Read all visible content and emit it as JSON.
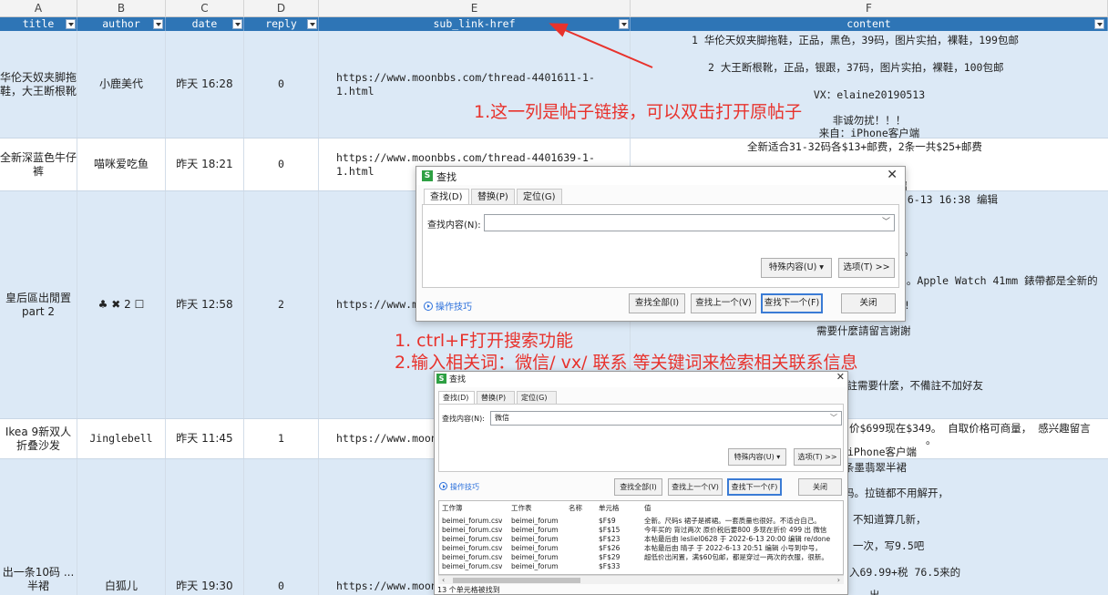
{
  "sheet": {
    "col_letters": [
      "A",
      "B",
      "C",
      "D",
      "E",
      "F"
    ],
    "headers": [
      "title",
      "author",
      "date",
      "reply",
      "sub_link-href",
      "content"
    ],
    "rows": [
      {
        "title": "华伦天奴夹脚拖鞋，大王断根靴",
        "author": "小鹿美代",
        "date": "昨天  16:28",
        "reply": "0",
        "link": "https://www.moonbbs.com/thread-4401611-1-1.html",
        "content": [
          "1 华伦天奴夹脚拖鞋，正品，黑色，39码，图片实拍，裸鞋，199包邮",
          "2 大王断根靴，正品，银跟，37码，图片实拍，裸鞋，100包邮",
          "VX：elaine20190513",
          "非诚勿扰！！！",
          "来自：iPhone客户端"
        ]
      },
      {
        "title": "全新深蓝色牛仔裤",
        "author": "喵咪爱吃鱼",
        "date": "昨天  18:21",
        "reply": "0",
        "link": "https://www.moonbbs.com/thread-4401639-1-1.html",
        "content": [
          "全新适合31-32码各$13+邮费，2条一共$25+邮费",
          "端"
        ]
      },
      {
        "title": "皇后區出閒置 part 2",
        "author": "♣ ✖  2 ☐",
        "date": "昨天  12:58",
        "reply": "2",
        "link": "https://www.mo",
        "content": [
          "2-6-13 16:38 编辑",
          "。",
          "f。Apple Watch 41mm 錶帶都是全新的",
          "!",
          "需要什麼請留言謝謝",
          "請註需要什麼，不備註不加好友"
        ]
      },
      {
        "title": "Ikea 9新双人折叠沙发",
        "author": "Jinglebell",
        "date": "昨天  11:45",
        "reply": "1",
        "link": "https://www.moon",
        "content": [
          "价$699现在$349。 自取价格可商量， 感兴趣留言",
          "。",
          "iPhone客户端"
        ]
      },
      {
        "title": "出一条10码 ... 半裙",
        "author": "白狐儿",
        "date": "昨天  19:30",
        "reply": "0",
        "link": "https://www.moon",
        "content": [
          "条墨翡翠半裙",
          "码。拉链都不用解开，",
          "不知道算几新，",
          "一次，写9.5吧",
          "入69.99+税 76.5来的",
          "出"
        ]
      }
    ]
  },
  "annotations": {
    "a1": "1.这一列是帖子链接，可以双击打开原帖子",
    "a2": "1. ctrl+F打开搜索功能",
    "a3": "2.输入相关词：微信/ vx/ 联系 等关键词来检索相关联系信息"
  },
  "dialog1": {
    "icon": "S",
    "title": "查找",
    "tabs": [
      "查找(D)",
      "替换(P)",
      "定位(G)"
    ],
    "find_label": "查找内容(N):",
    "find_value": "",
    "special_btn": "特殊内容(U) ▾",
    "options_btn": "选项(T) >>",
    "tips": "操作技巧",
    "find_all": "查找全部(I)",
    "find_prev": "查找上一个(V)",
    "find_next": "查找下一个(F)",
    "close": "关闭"
  },
  "dialog2": {
    "icon": "S",
    "title": "查找",
    "tabs": [
      "查找(D)",
      "替换(P)",
      "定位(G)"
    ],
    "find_label": "查找内容(N):",
    "find_value": "微信",
    "special_btn": "特殊内容(U) ▾",
    "options_btn": "选项(T) >>",
    "tips": "操作技巧",
    "find_all": "查找全部(I)",
    "find_prev": "查找上一个(V)",
    "find_next": "查找下一个(F)",
    "close": "关闭",
    "results_headers": [
      "工作簿",
      "工作表",
      "名称",
      "单元格",
      "值"
    ],
    "results": [
      [
        "beimei_forum.csv",
        "beimei_forum",
        "",
        "$F$9",
        "全新。尺码s  裙子是裤裙。一套质量也很好。不适合自己。"
      ],
      [
        "beimei_forum.csv",
        "beimei_forum",
        "",
        "$F$15",
        "今年买的  背过两次 原价税后要800 多现在折价 499 出 微信"
      ],
      [
        "beimei_forum.csv",
        "beimei_forum",
        "",
        "$F$23",
        "本帖最后由 lesliel0628 于 2022-6-13 20:00 编辑 re/done"
      ],
      [
        "beimei_forum.csv",
        "beimei_forum",
        "",
        "$F$26",
        "本帖最后由 晴子 于 2022-6-13 20:51 编辑 小号到中号，"
      ],
      [
        "beimei_forum.csv",
        "beimei_forum",
        "",
        "$F$29",
        "超低价出闲置，满$60包邮，都是穿过一两次的衣服，很新。"
      ],
      [
        "beimei_forum.csv",
        "beimei_forum",
        "",
        "$F$33",
        ""
      ]
    ],
    "status": "13 个单元格被找到"
  }
}
